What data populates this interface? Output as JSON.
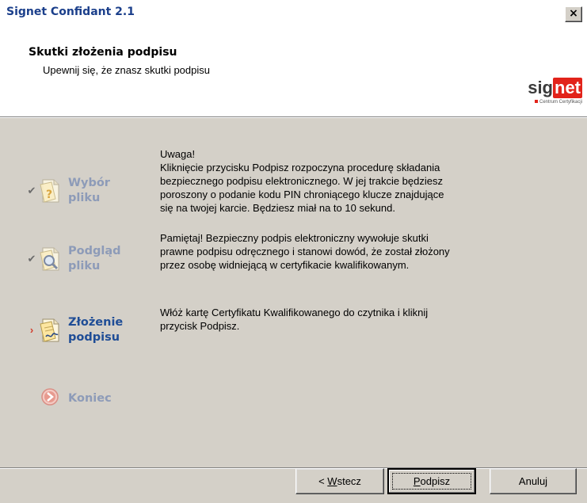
{
  "window": {
    "title": "Signet Confidant 2.1",
    "close_label": "×"
  },
  "header": {
    "title": "Skutki złożenia podpisu",
    "subtitle": "Upewnij się, że znasz skutki podpisu",
    "logo": {
      "sig": "sig",
      "net": "net",
      "tagline": "Centrum Certyfikacji"
    }
  },
  "steps": [
    {
      "line1": "Wybór",
      "line2": "pliku",
      "state": "done",
      "icon": "question-document-icon"
    },
    {
      "line1": "Podgląd",
      "line2": "pliku",
      "state": "done",
      "icon": "magnifier-document-icon"
    },
    {
      "line1": "Złożenie",
      "line2": "podpisu",
      "state": "current",
      "icon": "signature-document-icon"
    },
    {
      "line1": "Koniec",
      "line2": "",
      "state": "pending",
      "icon": "arrow-circle-icon"
    }
  ],
  "info": {
    "p1": "Uwaga!\nKliknięcie przycisku Podpisz rozpoczyna procedurę składania\nbezpiecznego podpisu elektronicznego. W jej trakcie będziesz\nporoszony o podanie kodu PIN chroniącego klucze znajdujące\nsię na twojej karcie. Będziesz miał na to 10 sekund.",
    "p2": "Pamiętaj! Bezpieczny podpis elektroniczny wywołuje skutki\nprawne podpisu odręcznego i stanowi dowód, że został złożony\nprzez osobę widniejącą w certyfikacie kwalifikowanym.",
    "p3": "Włóż kartę Certyfikatu Kwalifikowanego do czytnika i kliknij\nprzycisk Podpisz."
  },
  "buttons": {
    "back_prefix": "< ",
    "back_mnemonic": "W",
    "back_rest": "stecz",
    "sign_mnemonic": "P",
    "sign_rest": "odpisz",
    "cancel": "Anuluj"
  },
  "colors": {
    "title_blue": "#1b3f8b",
    "step_active": "#1f4d96",
    "step_inactive": "#8d9bb8",
    "brand_red": "#e2231a",
    "face": "#d4d0c8"
  }
}
